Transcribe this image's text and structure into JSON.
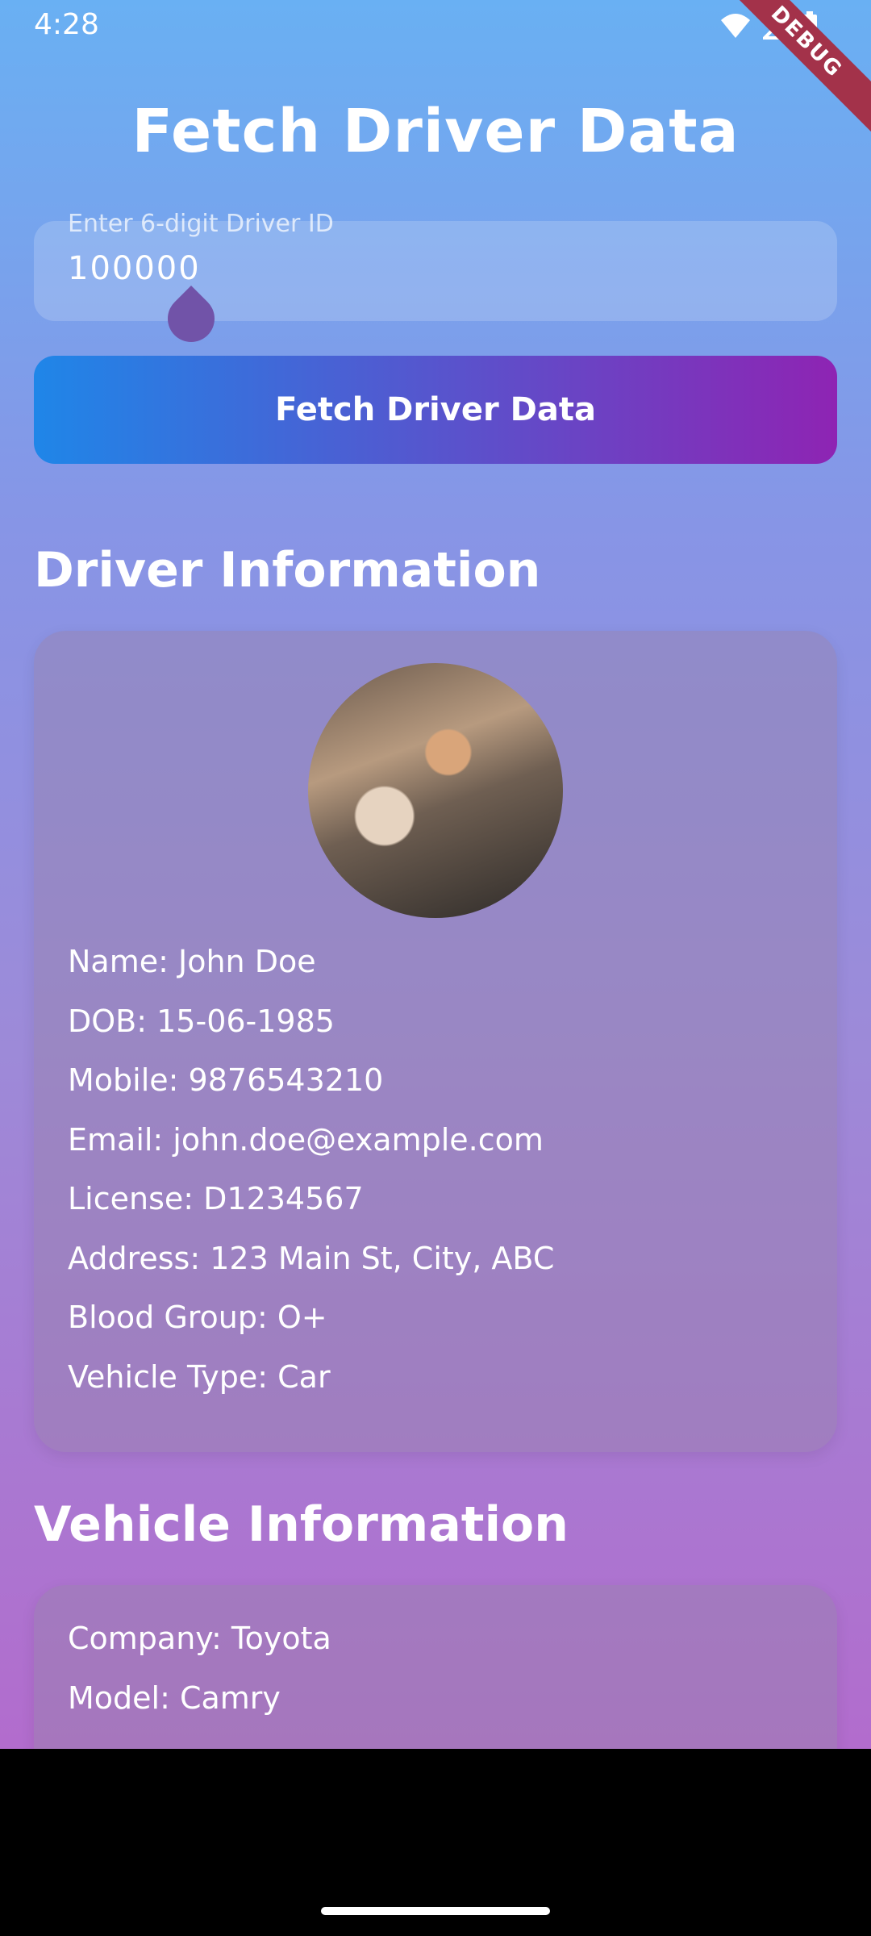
{
  "status": {
    "time": "4:28"
  },
  "debug_badge": "DEBUG",
  "header": {
    "title": "Fetch Driver Data"
  },
  "driver_id_input": {
    "label": "Enter 6-digit Driver ID",
    "value": "100000"
  },
  "fetch_button": {
    "label": "Fetch Driver Data"
  },
  "driver_section": {
    "title": "Driver Information",
    "lines": [
      "Name: John Doe",
      "DOB: 15-06-1985",
      "Mobile: 9876543210",
      "Email: john.doe@example.com",
      "License: D1234567",
      "Address: 123 Main St, City, ABC",
      "Blood Group: O+",
      "Vehicle Type: Car"
    ]
  },
  "vehicle_section": {
    "title": "Vehicle Information",
    "lines": [
      "Company: Toyota",
      "Model: Camry"
    ]
  },
  "colors": {
    "button_start": "#1f86e8",
    "button_end": "#8e24b3",
    "debug_ribbon": "#a3324a"
  }
}
